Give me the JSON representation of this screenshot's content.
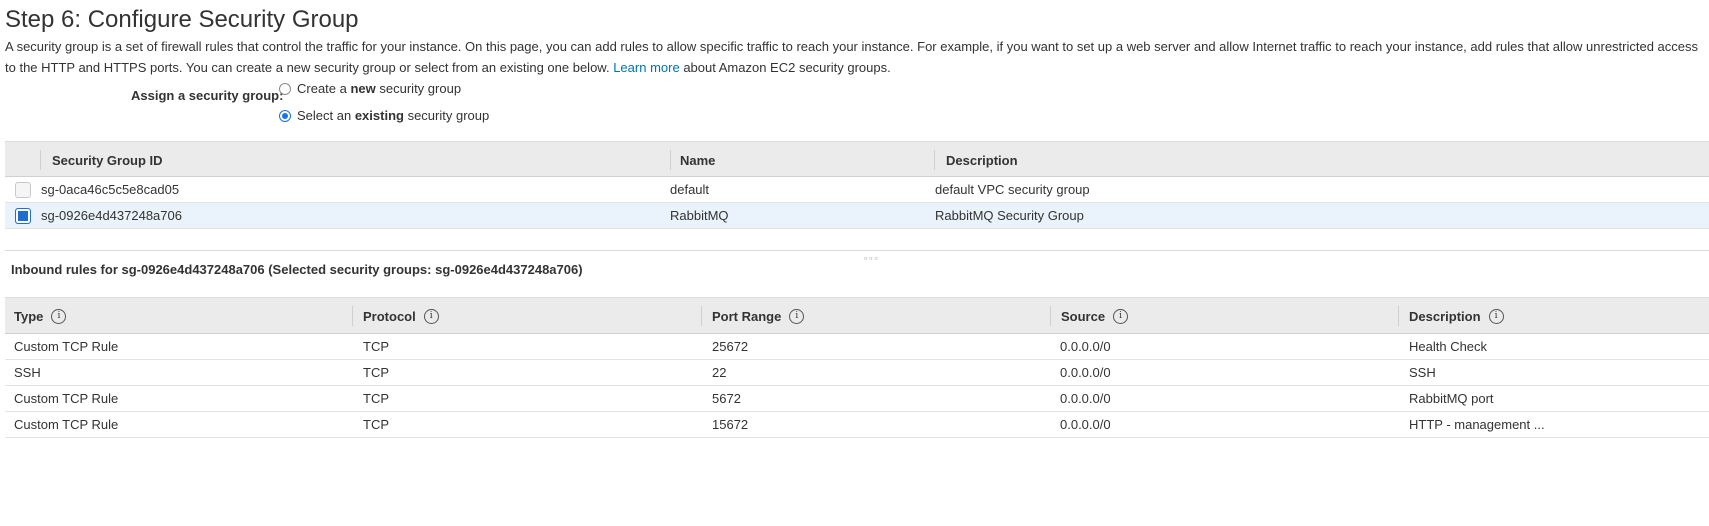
{
  "page": {
    "title": "Step 6: Configure Security Group",
    "intro_part1": "A security group is a set of firewall rules that control the traffic for your instance. On this page, you can add rules to allow specific traffic to reach your instance. For example, if you want to set up a web server and allow Internet traffic to reach your instance, add rules that allow unrestricted access to the HTTP and HTTPS ports. You can create a new security group or select from an existing one below.",
    "learn_more": "Learn more",
    "intro_part2": "about Amazon EC2 security groups."
  },
  "assign": {
    "label": "Assign a security group:",
    "options": [
      {
        "pre": "Create a ",
        "bold": "new",
        "post": " security group",
        "checked": false
      },
      {
        "pre": "Select an ",
        "bold": "existing",
        "post": " security group",
        "checked": true
      }
    ]
  },
  "sg_table": {
    "headers": [
      "Security Group ID",
      "Name",
      "Description"
    ],
    "rows": [
      {
        "id": "sg-0aca46c5c5e8cad05",
        "name": "default",
        "description": "default VPC security group",
        "selected": false
      },
      {
        "id": "sg-0926e4d437248a706",
        "name": "RabbitMQ",
        "description": "RabbitMQ Security Group",
        "selected": true
      }
    ]
  },
  "inbound": {
    "title": "Inbound rules for sg-0926e4d437248a706 (Selected security groups: sg-0926e4d437248a706)",
    "headers": [
      "Type",
      "Protocol",
      "Port Range",
      "Source",
      "Description"
    ],
    "info_glyph": "i",
    "rows": [
      {
        "type": "Custom TCP Rule",
        "protocol": "TCP",
        "port": "25672",
        "source": "0.0.0.0/0",
        "description": "Health Check"
      },
      {
        "type": "SSH",
        "protocol": "TCP",
        "port": "22",
        "source": "0.0.0.0/0",
        "description": "SSH"
      },
      {
        "type": "Custom TCP Rule",
        "protocol": "TCP",
        "port": "5672",
        "source": "0.0.0.0/0",
        "description": "RabbitMQ port"
      },
      {
        "type": "Custom TCP Rule",
        "protocol": "TCP",
        "port": "15672",
        "source": "0.0.0.0/0",
        "description": "HTTP - management ..."
      }
    ]
  },
  "colors": {
    "link": "#0073bb",
    "selected_row": "#eaf3fb",
    "checkbox_checked": "#1f6fce",
    "header_bg": "#ebebeb"
  }
}
